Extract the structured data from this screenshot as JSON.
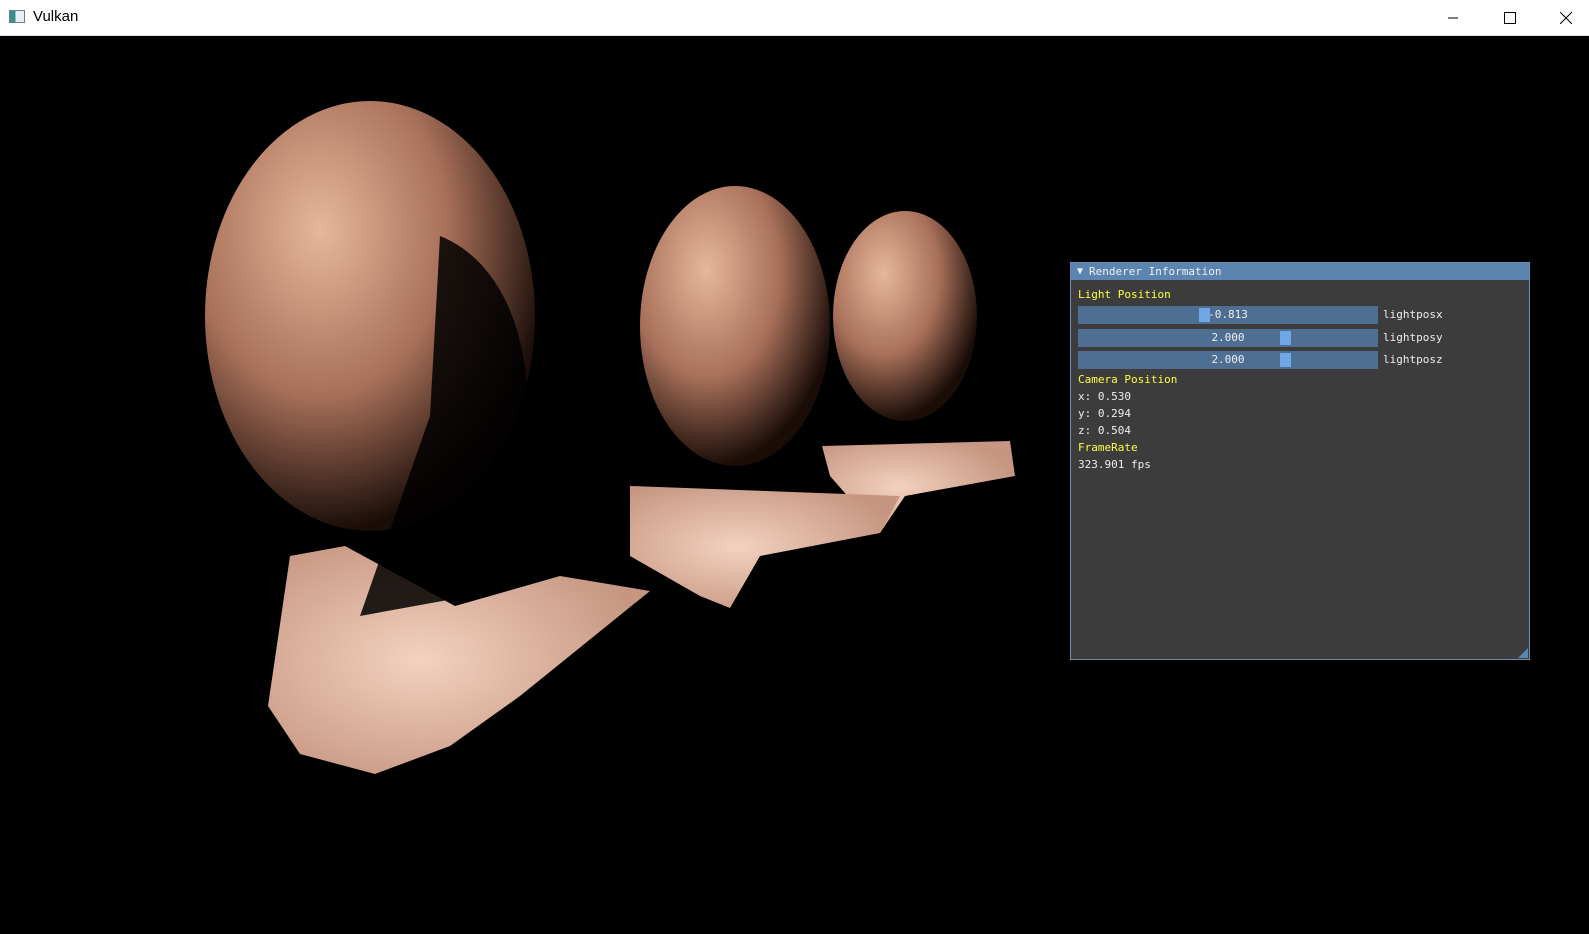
{
  "window": {
    "title": "Vulkan"
  },
  "panel": {
    "title": "Renderer Information",
    "light_section": "Light Position",
    "sliders": [
      {
        "value": "-0.813",
        "label": "lightposx",
        "fraction": 0.42
      },
      {
        "value": "2.000",
        "label": "lightposy",
        "fraction": 0.7
      },
      {
        "value": "2.000",
        "label": "lightposz",
        "fraction": 0.7
      }
    ],
    "camera_section": "Camera Position",
    "camera": {
      "x": "x: 0.530",
      "y": "y: 0.294",
      "z": "z: 0.504"
    },
    "framerate_section": "FrameRate",
    "fps": "323.901 fps"
  },
  "colors": {
    "panel_bg": "#3c3c3c",
    "header": "#5b84b0",
    "section_text": "#ffff40",
    "slider_bg": "#4f6f92",
    "grab": "#6fa6e6"
  },
  "icons": [
    "app-icon",
    "minimize-icon",
    "maximize-icon",
    "close-icon",
    "collapse-triangle-icon"
  ]
}
